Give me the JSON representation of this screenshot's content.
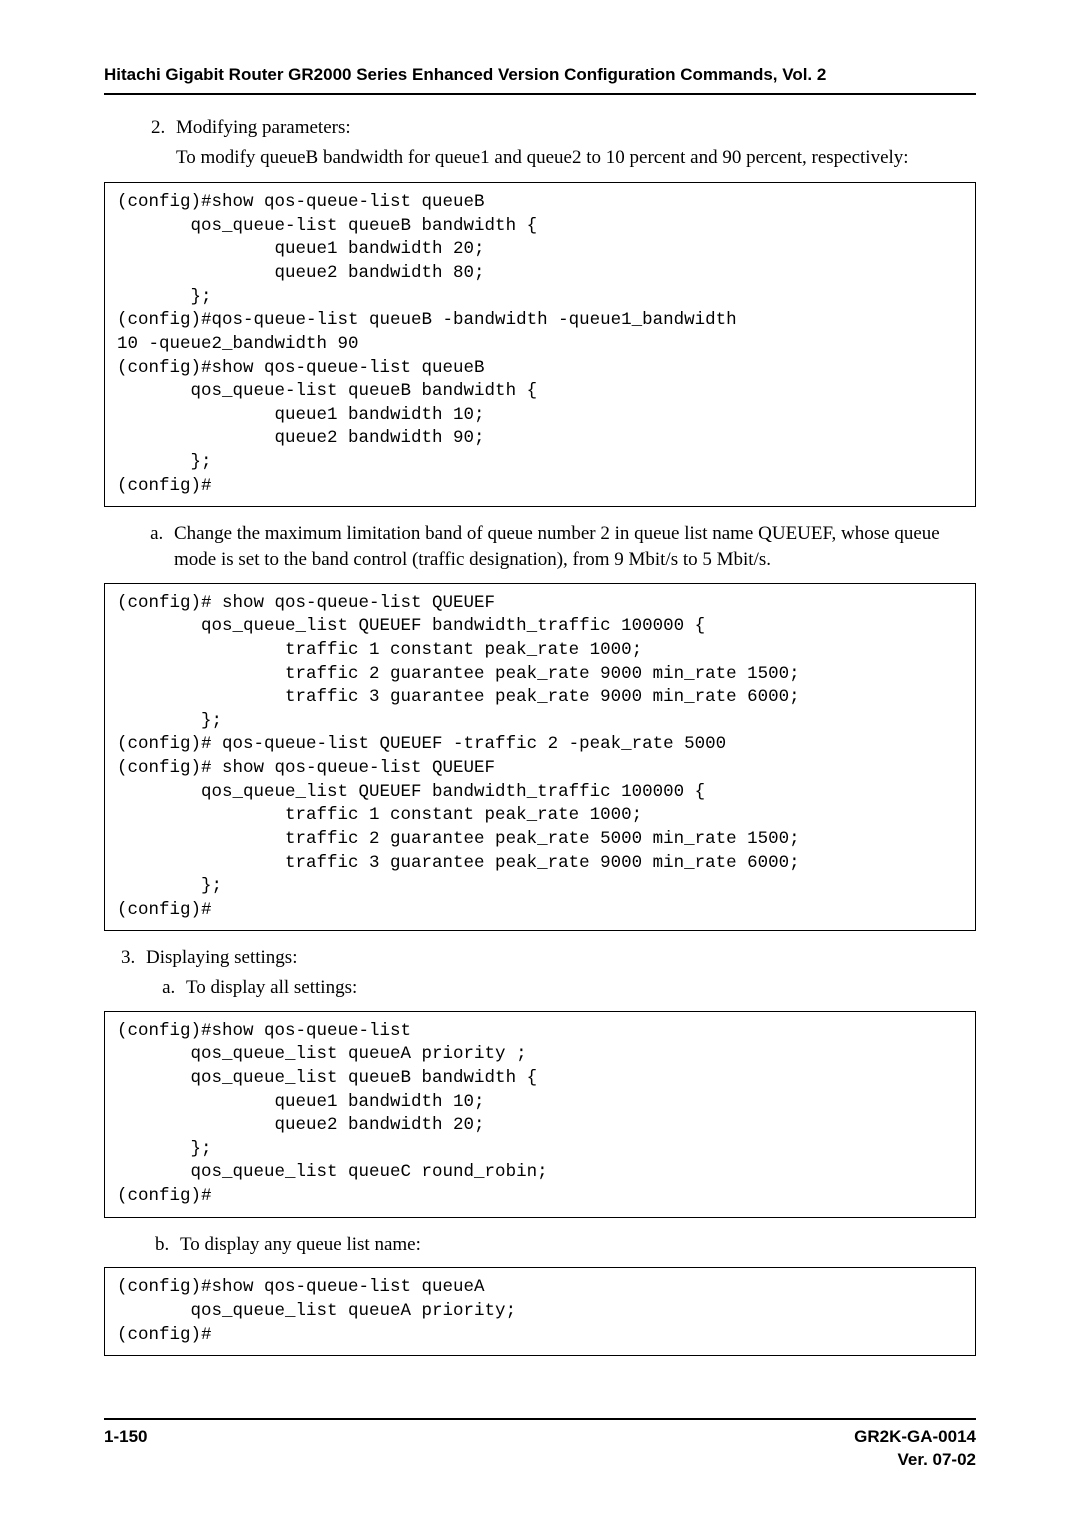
{
  "header": {
    "running_title": "Hitachi Gigabit Router GR2000 Series Enhanced Version Configuration Commands, Vol. 2"
  },
  "content": {
    "item2": {
      "title": "Modifying parameters:",
      "para": "To modify queueB bandwidth for queue1 and queue2 to 10 percent and 90 percent, respectively:"
    },
    "code1": "(config)#show qos-queue-list queueB\n       qos_queue-list queueB bandwidth {\n               queue1 bandwidth 20;\n               queue2 bandwidth 80;\n       };\n(config)#qos-queue-list queueB -bandwidth -queue1_bandwidth\n10 -queue2_bandwidth 90\n(config)#show qos-queue-list queueB\n       qos_queue-list queueB bandwidth {\n               queue1 bandwidth 10;\n               queue2 bandwidth 90;\n       };\n(config)#",
    "item2a": "Change the maximum limitation band of queue number 2 in queue list name QUEUEF, whose queue mode is set to the band control (traffic designation), from 9 Mbit/s to 5 Mbit/s.",
    "code2": "(config)# show qos-queue-list QUEUEF\n        qos_queue_list QUEUEF bandwidth_traffic 100000 {\n                traffic 1 constant peak_rate 1000;\n                traffic 2 guarantee peak_rate 9000 min_rate 1500;\n                traffic 3 guarantee peak_rate 9000 min_rate 6000;\n        };\n(config)# qos-queue-list QUEUEF -traffic 2 -peak_rate 5000\n(config)# show qos-queue-list QUEUEF\n        qos_queue_list QUEUEF bandwidth_traffic 100000 {\n                traffic 1 constant peak_rate 1000;\n                traffic 2 guarantee peak_rate 5000 min_rate 1500;\n                traffic 3 guarantee peak_rate 9000 min_rate 6000;\n        };\n(config)#",
    "item3": {
      "title": "Displaying settings:",
      "a": "To display all settings:"
    },
    "code3": "(config)#show qos-queue-list\n       qos_queue_list queueA priority ;\n       qos_queue_list queueB bandwidth {\n               queue1 bandwidth 10;\n               queue2 bandwidth 20;\n       };\n       qos_queue_list queueC round_robin;\n(config)#",
    "item3b": "To display any queue list name:",
    "code4": "(config)#show qos-queue-list queueA\n       qos_queue_list queueA priority;\n(config)#"
  },
  "footer": {
    "page": "1-150",
    "doc": "GR2K-GA-0014",
    "ver": "Ver. 07-02"
  }
}
